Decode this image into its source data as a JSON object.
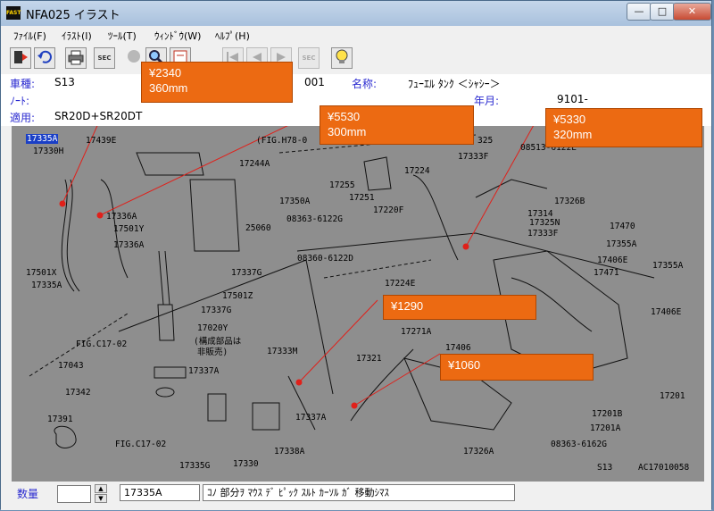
{
  "window": {
    "title": "NFA025 イラスト",
    "app_icon_label": "FAST",
    "min_glyph": "—",
    "max_glyph": "□",
    "close_glyph": "✕"
  },
  "menu": [
    {
      "label": "ﾌｧｲﾙ(F)"
    },
    {
      "label": "ｲﾗｽﾄ(I)"
    },
    {
      "label": "ﾂｰﾙ(T)"
    },
    {
      "label": "ｳｨﾝﾄﾞｳ(W)"
    },
    {
      "label": "ﾍﾙﾌﾟ(H)"
    }
  ],
  "toolbar": {
    "sec1_label": "SEC",
    "sec2_label": "SEC"
  },
  "info": {
    "model_label": "車種:",
    "model_value": "S13",
    "code_value": "001",
    "name_label": "名称:",
    "name_value": "ﾌｭｰｴﾙ ﾀﾝｸ ＜ｼｬｼｰ＞",
    "note_label": "ﾉｰﾄ:",
    "yearmonth_label": "年月:",
    "yearmonth_value": "9101-",
    "applies_label": "適用:",
    "applies_value": "SR20D+SR20DT"
  },
  "drawing": {
    "parts": [
      {
        "label": "17335A",
        "selected": true
      },
      {
        "label": "17439E"
      },
      {
        "label": "17330H"
      },
      {
        "label": "(FIG.H78-0"
      },
      {
        "label": "325"
      },
      {
        "label": "08513-6122E"
      },
      {
        "label": "17244A"
      },
      {
        "label": "17255"
      },
      {
        "label": "17224"
      },
      {
        "label": "17333F"
      },
      {
        "label": "17350A"
      },
      {
        "label": "17251"
      },
      {
        "label": "17220F"
      },
      {
        "label": "17326B"
      },
      {
        "label": "17314"
      },
      {
        "label": "17336A"
      },
      {
        "label": "17501Y"
      },
      {
        "label": "17336A"
      },
      {
        "label": "08363-6122G"
      },
      {
        "label": "25060"
      },
      {
        "label": "17325N"
      },
      {
        "label": "17333F"
      },
      {
        "label": "17470"
      },
      {
        "label": "17355A"
      },
      {
        "label": "17406E"
      },
      {
        "label": "17471"
      },
      {
        "label": "17355A"
      },
      {
        "label": "08360-6122D"
      },
      {
        "label": "17501X"
      },
      {
        "label": "17335A"
      },
      {
        "label": "17337G"
      },
      {
        "label": "17224E"
      },
      {
        "label": "17501Z"
      },
      {
        "label": "17337G"
      },
      {
        "label": "17406E"
      },
      {
        "label": "17020Y"
      },
      {
        "label": "(構成部品は"
      },
      {
        "label": "非販売)"
      },
      {
        "label": "17271A"
      },
      {
        "label": "17406"
      },
      {
        "label": "FIG.C17-02"
      },
      {
        "label": "17043"
      },
      {
        "label": "17333M"
      },
      {
        "label": "17321"
      },
      {
        "label": "17337A"
      },
      {
        "label": "17342"
      },
      {
        "label": "17201"
      },
      {
        "label": "17337A"
      },
      {
        "label": "17201B"
      },
      {
        "label": "17391"
      },
      {
        "label": "17201A"
      },
      {
        "label": "FIG.C17-02"
      },
      {
        "label": "17338A"
      },
      {
        "label": "17326A"
      },
      {
        "label": "08363-6162G"
      },
      {
        "label": "17335G"
      },
      {
        "label": "17330"
      },
      {
        "label": "S13"
      },
      {
        "label": "AC17010058"
      }
    ]
  },
  "callouts": [
    {
      "price": "¥2340",
      "length": "360mm"
    },
    {
      "price": "¥5530",
      "length": "300mm"
    },
    {
      "price": "¥5330",
      "length": "320mm"
    },
    {
      "price": "¥1290",
      "length": ""
    },
    {
      "price": "¥1060",
      "length": ""
    }
  ],
  "status": {
    "qty_label": "数量",
    "qty_value": "",
    "part_no": "17335A",
    "message": "ｺﾉ 部分ｦ ﾏｳｽ ﾃﾞ ﾋﾟｯｸ ｽﾙﾄ ｶｰｿﾙ ｶﾞ 移動ｼﾏｽ",
    "spin_up": "▲",
    "spin_down": "▼"
  },
  "colors": {
    "callout": "#ec6a12",
    "label_blue": "#2a2ad0",
    "leader_red": "#e0201a",
    "drawing_bg": "#8e8e8e",
    "selection": "#1a3fc6"
  }
}
